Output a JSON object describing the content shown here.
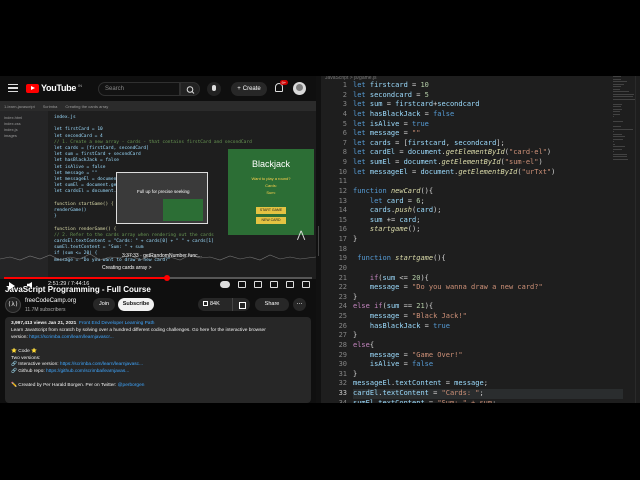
{
  "youtube": {
    "logo_text": "YouTube",
    "country": "IN",
    "search_placeholder": "Search",
    "create_label": "Create",
    "notification_count": "9+",
    "player": {
      "tabs": [
        "1-learn-javascript",
        "Scrimba",
        "Creating the cards array"
      ],
      "side_items": [
        "index.html",
        "index.css",
        "index.js",
        "images"
      ],
      "code_lines": [
        "index.js",
        "",
        "let firstCard = 10",
        "let secondCard = 4",
        "// 1. Create a new array - cards - that contains firstCard and secondCard",
        "let cards = [firstCard, secondCard]",
        "let sum = firstCard + secondCard",
        "let hasBlackJack = false",
        "let isAlive = false",
        "let message = \"\"",
        "let messageEl = document.getElementById(\"message-el\")",
        "let sumEl = document.getElementById(\"sum-el\")",
        "let cardsEl = document.getElementById(\"cards-el\")",
        "",
        "function startGame() {",
        "    renderGame()",
        "}",
        "",
        "function renderGame() {",
        "    // 2. Refer to the cards array when rendering out the cards",
        "    cardsEl.textContent = \"Cards: \" + cards[0] + \" \" + cards[1]",
        "    sumEl.textContent = \"Sum: \" + sum",
        "    if (sum <= 20) {",
        "        message = \"Do you want to draw a new card?\""
      ],
      "preview": {
        "title": "Blackjack",
        "line1": "Want to play a round?",
        "line2": "Cards:",
        "line3": "Sum:",
        "button1": "START GAME",
        "button2": "NEW CARD"
      },
      "tooltip_title": "Full up for precise seeking",
      "chapter_time": "3:37:33 · getRandomNumber func...",
      "chapter_name": "Creating cards array >",
      "progress_fraction": 0.53
    },
    "controls": {
      "time": "2:51:29 / 7:44:16"
    },
    "video": {
      "title": "JavaScript Programming - Full Course",
      "channel": "freeCodeCamp.org",
      "subscribers": "11.7M subscribers",
      "join_label": "Join",
      "subscribe_label": "Subscribe",
      "likes": "84K",
      "share_label": "Share",
      "more_label": "...",
      "stats": "3,997,413 views  Jan 21, 2021",
      "tag": "Front End Developer Learning Path",
      "desc_line1": "Learn JavaScript from scratch by solving over a hundred different coding challenges. Go here for the interactive browser",
      "desc_line2_prefix": "version: ",
      "desc_line2_link": "https://scrimba.com/learn/learnjavascr...",
      "code_heading": "⭐ Code ⭐",
      "two_versions": "Two versions:",
      "interactive_prefix": "🔗 Interactive version: ",
      "interactive_link": "https://scrimba.com/learn/learnjavasc...",
      "github_prefix": "🔗 Github repo: ",
      "github_link": "https://github.com/scrimba/learnjavas...",
      "created_by": "✏️ Created by Per Harald Borgen. Per on Twitter: ",
      "twitter": "@perborgen"
    }
  },
  "editor": {
    "breadcrumb": "JavaScript > js/game.js",
    "line_numbers": [
      "1",
      "2",
      "3",
      "4",
      "5",
      "6",
      "7",
      "8",
      "9",
      "10",
      "11",
      "12",
      "13",
      "14",
      "15",
      "16",
      "17",
      "18",
      "19",
      "20",
      "21",
      "22",
      "23",
      "24",
      "25",
      "26",
      "27",
      "28",
      "29",
      "30",
      "31",
      "32",
      "33",
      "34"
    ],
    "active_line": "33",
    "lines": [
      [
        {
          "t": "let ",
          "c": "k"
        },
        {
          "t": "firstcard",
          "c": "v"
        },
        {
          "t": " = ",
          "c": "o"
        },
        {
          "t": "10",
          "c": "n"
        }
      ],
      [
        {
          "t": "let ",
          "c": "k"
        },
        {
          "t": "secondcard",
          "c": "v"
        },
        {
          "t": " = ",
          "c": "o"
        },
        {
          "t": "5",
          "c": "n"
        }
      ],
      [
        {
          "t": "let ",
          "c": "k"
        },
        {
          "t": "sum",
          "c": "v"
        },
        {
          "t": " = ",
          "c": "o"
        },
        {
          "t": "firstcard",
          "c": "v"
        },
        {
          "t": "+",
          "c": "o"
        },
        {
          "t": "secondcard",
          "c": "v"
        }
      ],
      [
        {
          "t": "let ",
          "c": "k"
        },
        {
          "t": "hasBlackJack",
          "c": "v"
        },
        {
          "t": " = ",
          "c": "o"
        },
        {
          "t": "false",
          "c": "k"
        }
      ],
      [
        {
          "t": "let ",
          "c": "k"
        },
        {
          "t": "isAlive",
          "c": "v"
        },
        {
          "t": " = ",
          "c": "o"
        },
        {
          "t": "true",
          "c": "k"
        }
      ],
      [
        {
          "t": "let ",
          "c": "k"
        },
        {
          "t": "message",
          "c": "v"
        },
        {
          "t": " = ",
          "c": "o"
        },
        {
          "t": "\"\"",
          "c": "s"
        }
      ],
      [
        {
          "t": "let ",
          "c": "k"
        },
        {
          "t": "cards",
          "c": "v"
        },
        {
          "t": " = [",
          "c": "o"
        },
        {
          "t": "firstcard",
          "c": "v"
        },
        {
          "t": ", ",
          "c": "o"
        },
        {
          "t": "secondcard",
          "c": "v"
        },
        {
          "t": "];",
          "c": "o"
        }
      ],
      [
        {
          "t": "let ",
          "c": "k"
        },
        {
          "t": "cardEl",
          "c": "v"
        },
        {
          "t": " = ",
          "c": "o"
        },
        {
          "t": "document",
          "c": "v"
        },
        {
          "t": ".",
          "c": "o"
        },
        {
          "t": "getElementById",
          "c": "f"
        },
        {
          "t": "(",
          "c": "o"
        },
        {
          "t": "\"card-el\"",
          "c": "s"
        },
        {
          "t": ")",
          "c": "o"
        }
      ],
      [
        {
          "t": "let ",
          "c": "k"
        },
        {
          "t": "sumEl",
          "c": "v"
        },
        {
          "t": " = ",
          "c": "o"
        },
        {
          "t": "document",
          "c": "v"
        },
        {
          "t": ".",
          "c": "o"
        },
        {
          "t": "getElementById",
          "c": "f"
        },
        {
          "t": "(",
          "c": "o"
        },
        {
          "t": "\"sum-el\"",
          "c": "s"
        },
        {
          "t": ")",
          "c": "o"
        }
      ],
      [
        {
          "t": "let ",
          "c": "k"
        },
        {
          "t": "messageEl",
          "c": "v"
        },
        {
          "t": " = ",
          "c": "o"
        },
        {
          "t": "document",
          "c": "v"
        },
        {
          "t": ".",
          "c": "o"
        },
        {
          "t": "getElementById",
          "c": "f"
        },
        {
          "t": "(",
          "c": "o"
        },
        {
          "t": "\"urTxt\"",
          "c": "s"
        },
        {
          "t": ")",
          "c": "o"
        }
      ],
      [],
      [
        {
          "t": "function ",
          "c": "k"
        },
        {
          "t": "newCard",
          "c": "f"
        },
        {
          "t": "(){",
          "c": "o"
        }
      ],
      [
        {
          "t": "    let ",
          "c": "k"
        },
        {
          "t": "card",
          "c": "v"
        },
        {
          "t": " = ",
          "c": "o"
        },
        {
          "t": "6",
          "c": "n"
        },
        {
          "t": ";",
          "c": "o"
        }
      ],
      [
        {
          "t": "    cards",
          "c": "v"
        },
        {
          "t": ".",
          "c": "o"
        },
        {
          "t": "push",
          "c": "f"
        },
        {
          "t": "(",
          "c": "o"
        },
        {
          "t": "card",
          "c": "v"
        },
        {
          "t": ");",
          "c": "o"
        }
      ],
      [
        {
          "t": "    sum",
          "c": "v"
        },
        {
          "t": " += ",
          "c": "o"
        },
        {
          "t": "card",
          "c": "v"
        },
        {
          "t": ";",
          "c": "o"
        }
      ],
      [
        {
          "t": "    ",
          "c": "o"
        },
        {
          "t": "startgame",
          "c": "f"
        },
        {
          "t": "();",
          "c": "o"
        }
      ],
      [
        {
          "t": "}",
          "c": "o"
        }
      ],
      [],
      [
        {
          "t": " function ",
          "c": "k"
        },
        {
          "t": "startgame",
          "c": "f"
        },
        {
          "t": "(){",
          "c": "o"
        }
      ],
      [],
      [
        {
          "t": "    if",
          "c": "ctl"
        },
        {
          "t": "(",
          "c": "o"
        },
        {
          "t": "sum",
          "c": "v"
        },
        {
          "t": " <= ",
          "c": "o"
        },
        {
          "t": "20",
          "c": "n"
        },
        {
          "t": "){",
          "c": "o"
        }
      ],
      [
        {
          "t": "    message",
          "c": "v"
        },
        {
          "t": " = ",
          "c": "o"
        },
        {
          "t": "\"Do you wanna draw a new card?\"",
          "c": "s"
        }
      ],
      [
        {
          "t": "}",
          "c": "o"
        }
      ],
      [
        {
          "t": "else if",
          "c": "ctl"
        },
        {
          "t": "(",
          "c": "o"
        },
        {
          "t": "sum",
          "c": "v"
        },
        {
          "t": " == ",
          "c": "o"
        },
        {
          "t": "21",
          "c": "n"
        },
        {
          "t": "){",
          "c": "o"
        }
      ],
      [
        {
          "t": "    message",
          "c": "v"
        },
        {
          "t": " = ",
          "c": "o"
        },
        {
          "t": "\"Black Jack!\"",
          "c": "s"
        }
      ],
      [
        {
          "t": "    hasBlackJack",
          "c": "v"
        },
        {
          "t": " = ",
          "c": "o"
        },
        {
          "t": "true",
          "c": "k"
        }
      ],
      [
        {
          "t": "}",
          "c": "o"
        }
      ],
      [
        {
          "t": "else",
          "c": "ctl"
        },
        {
          "t": "{",
          "c": "o"
        }
      ],
      [
        {
          "t": "    message",
          "c": "v"
        },
        {
          "t": " = ",
          "c": "o"
        },
        {
          "t": "\"Game Over!\"",
          "c": "s"
        }
      ],
      [
        {
          "t": "    isAlive",
          "c": "v"
        },
        {
          "t": " = ",
          "c": "o"
        },
        {
          "t": "false",
          "c": "k"
        }
      ],
      [
        {
          "t": "}",
          "c": "o"
        }
      ],
      [
        {
          "t": "messageEl",
          "c": "v"
        },
        {
          "t": ".",
          "c": "o"
        },
        {
          "t": "textContent",
          "c": "v"
        },
        {
          "t": " = ",
          "c": "o"
        },
        {
          "t": "message",
          "c": "v"
        },
        {
          "t": ";",
          "c": "o"
        }
      ],
      [
        {
          "t": "cardEl",
          "c": "v"
        },
        {
          "t": ".",
          "c": "o"
        },
        {
          "t": "textContent",
          "c": "v"
        },
        {
          "t": " = ",
          "c": "o"
        },
        {
          "t": "\"Cards: \"",
          "c": "s"
        },
        {
          "t": ";",
          "c": "o"
        }
      ],
      [
        {
          "t": "sumEl",
          "c": "v"
        },
        {
          "t": ".",
          "c": "o"
        },
        {
          "t": "textContent",
          "c": "v"
        },
        {
          "t": " = ",
          "c": "o"
        },
        {
          "t": "\"Sum: \" + sum",
          "c": "s"
        },
        {
          "t": ";",
          "c": "o"
        }
      ]
    ]
  }
}
